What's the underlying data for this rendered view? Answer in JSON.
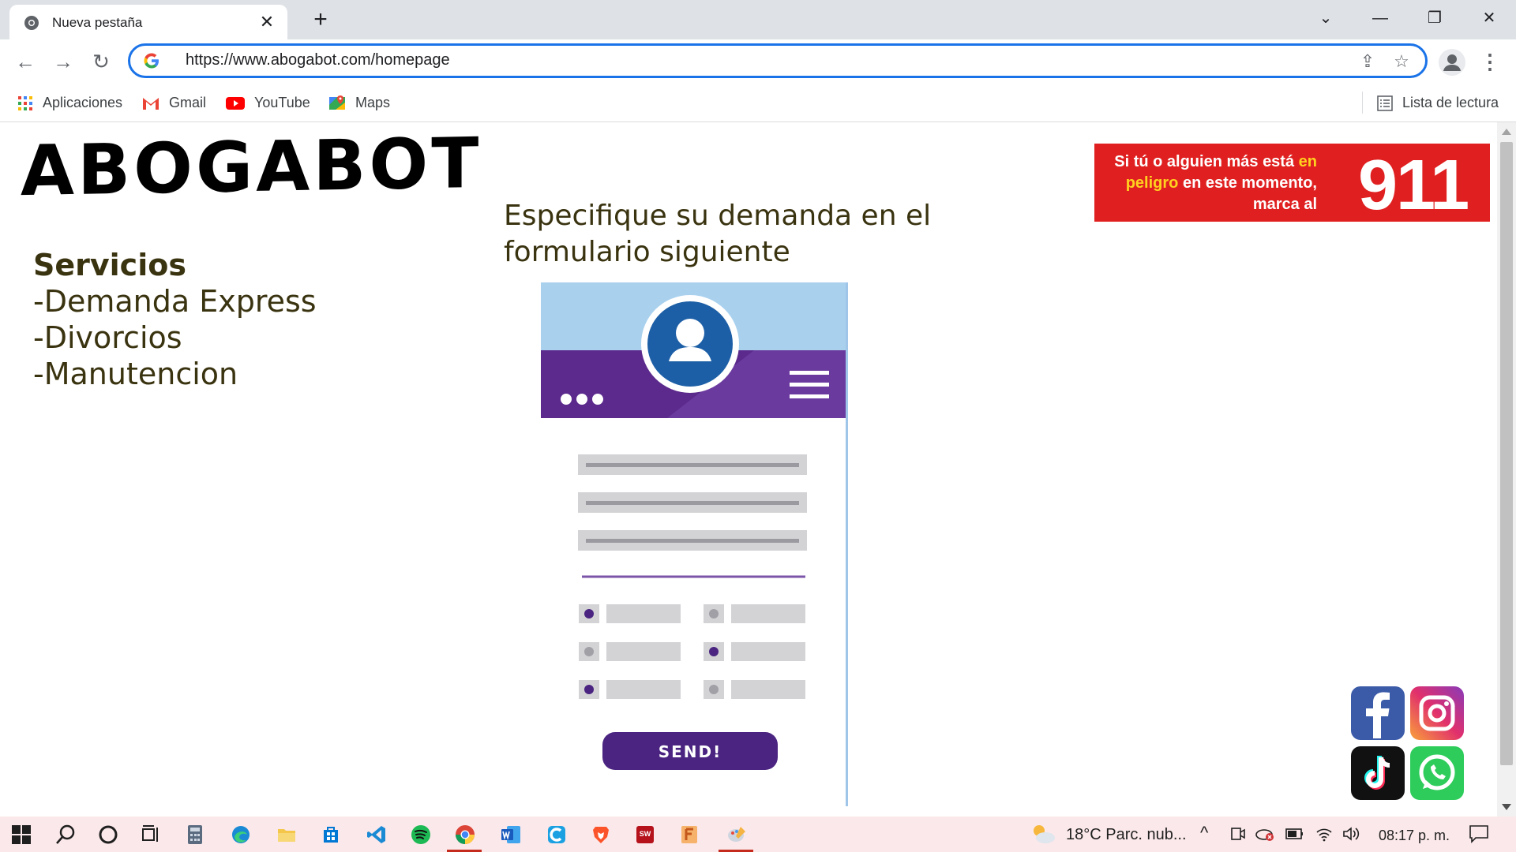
{
  "browser": {
    "tab_title": "Nueva pestaña",
    "url": "https://www.abogabot.com/homepage",
    "bookmarks": [
      "Aplicaciones",
      "Gmail",
      "YouTube",
      "Maps"
    ],
    "reading_list": "Lista de lectura"
  },
  "page": {
    "logo_text": "ABOGABOT",
    "services_heading": "Servicios",
    "services": [
      "-Demanda Express",
      "-Divorcios",
      "-Manutencion"
    ],
    "form_heading": "Especifique su demanda en el formulario siguiente",
    "form_send_label": "SEND!",
    "emergency": {
      "line1_a": "Si tú o alguien más está ",
      "line1_hl": "en",
      "line2_hl": "peligro",
      "line2_b": " en este momento,",
      "line3": "marca al",
      "number": "911"
    },
    "social": [
      "facebook",
      "instagram",
      "tiktok",
      "whatsapp"
    ]
  },
  "taskbar": {
    "weather": "18°C  Parc. nub...",
    "time": "08:17 p. m."
  },
  "colors": {
    "accent": "#1a73e8",
    "text_dark_olive": "#3a3310",
    "emergency_red": "#e02020",
    "emergency_highlight": "#ffd21f",
    "form_purple": "#5b2a8c",
    "form_sky": "#a9d1ee"
  }
}
